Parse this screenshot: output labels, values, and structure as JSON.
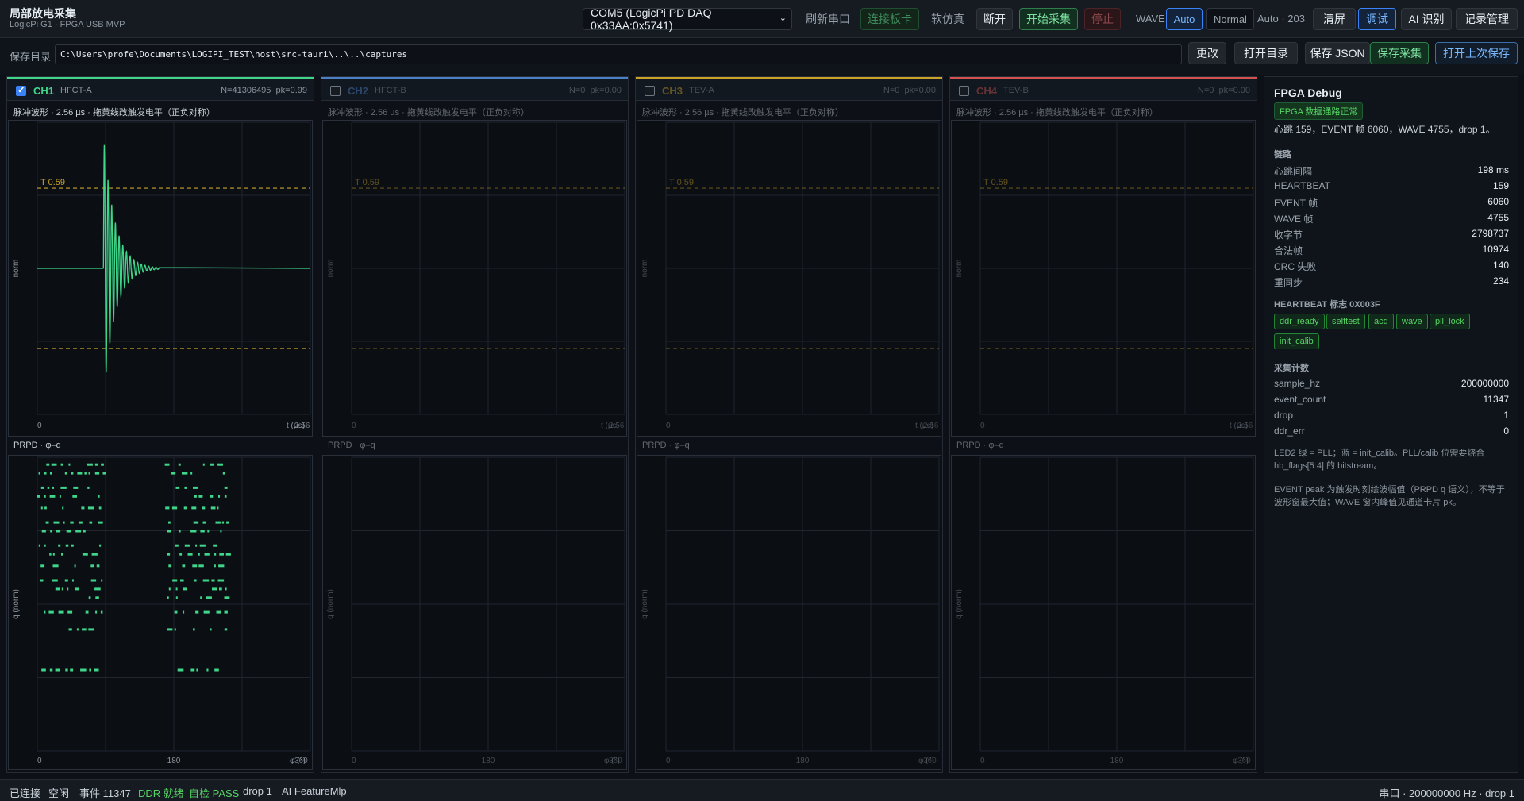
{
  "app": {
    "title": "局部放电采集",
    "subtitle": "LogicPi G1 · FPGA USB MVP"
  },
  "toolbar": {
    "port": "COM5 (LogicPi PD DAQ 0x33AA:0x5741)",
    "refresh": "刷新串口",
    "connect": "连接板卡",
    "simulate": "软仿真",
    "disconnect": "断开",
    "start": "开始采集",
    "stop": "停止",
    "wave_label": "WAVE",
    "mode_auto": "Auto",
    "mode_normal": "Normal",
    "mode_status": "Auto · 203",
    "clear": "清屏",
    "debug": "调试",
    "ai": "AI 识别",
    "records": "记录管理"
  },
  "savebar": {
    "label": "保存目录",
    "path": "C:\\Users\\profe\\Documents\\LOGIPI_TEST\\host\\src-tauri\\..\\..\\captures",
    "change": "更改",
    "open_dir": "打开目录",
    "save_json": "保存 JSON",
    "save_capture": "保存采集",
    "open_last": "打开上次保存"
  },
  "channels": [
    {
      "id": "CH1",
      "name": "HFCT-A",
      "checked": true,
      "color": "#3fd68a",
      "n": "N=41306495",
      "pk": "pk=0.99",
      "active": true
    },
    {
      "id": "CH2",
      "name": "HFCT-B",
      "checked": false,
      "color": "#4b7fc8",
      "n": "N=0",
      "pk": "pk=0.00",
      "active": false
    },
    {
      "id": "CH3",
      "name": "TEV-A",
      "checked": false,
      "color": "#c9a227",
      "n": "N=0",
      "pk": "pk=0.00",
      "active": false
    },
    {
      "id": "CH4",
      "name": "TEV-B",
      "checked": false,
      "color": "#d1524f",
      "n": "N=0",
      "pk": "pk=0.00",
      "active": false
    }
  ],
  "plots": {
    "wave_caption": "脉冲波形 · 2.56 µs · 拖黄线改触发电平（正负对称）",
    "wave_ylabel": "norm",
    "wave_x0": "0",
    "wave_xend": "t (µs)",
    "wave_xmax": "2.56",
    "trigger_label": "T 0.59",
    "prpd_caption": "PRPD · φ–q",
    "prpd_ylabel": "q (norm)",
    "prpd_x0": "0",
    "prpd_xmid": "180",
    "prpd_xend": "φ (°)",
    "prpd_xmax": "360"
  },
  "chart_data": [
    {
      "type": "line",
      "title": "脉冲波形 · 2.56 µs · 拖黄线改触发电平（正负对称）",
      "xlabel": "t (µs)",
      "ylabel": "norm",
      "xlim": [
        0,
        2.56
      ],
      "ylim": [
        -1,
        1
      ],
      "trigger_level": 0.59,
      "series": [
        {
          "name": "CH1",
          "pulse_start_us": 0.62,
          "peak": 0.99,
          "decay_end_us": 1.15
        }
      ]
    },
    {
      "type": "scatter",
      "title": "PRPD · φ–q",
      "xlabel": "φ (°)",
      "ylabel": "q (norm)",
      "xlim": [
        0,
        360
      ],
      "ylim": [
        0,
        1
      ],
      "clusters": [
        {
          "phase_range": [
            0,
            88
          ],
          "q_levels": [
            0.99,
            0.96,
            0.91,
            0.88,
            0.84,
            0.79,
            0.76,
            0.71,
            0.68,
            0.64,
            0.59,
            0.56,
            0.53,
            0.48,
            0.42,
            0.28
          ]
        },
        {
          "phase_range": [
            168,
            250
          ],
          "q_levels": [
            0.99,
            0.96,
            0.91,
            0.88,
            0.84,
            0.79,
            0.76,
            0.71,
            0.68,
            0.64,
            0.59,
            0.56,
            0.53,
            0.48,
            0.42,
            0.28
          ]
        }
      ]
    }
  ],
  "debug": {
    "title": "FPGA Debug",
    "badge": "FPGA 数据通路正常",
    "summary": "心跳 159，EVENT 帧 6060，WAVE 4755，drop 1。",
    "link_title": "链路",
    "link": [
      {
        "k": "心跳间隔",
        "v": "198 ms"
      },
      {
        "k": "HEARTBEAT",
        "v": "159"
      },
      {
        "k": "EVENT 帧",
        "v": "6060"
      },
      {
        "k": "WAVE 帧",
        "v": "4755"
      },
      {
        "k": "收字节",
        "v": "2798737"
      },
      {
        "k": "合法帧",
        "v": "10974"
      },
      {
        "k": "CRC 失败",
        "v": "140"
      },
      {
        "k": "重同步",
        "v": "234"
      }
    ],
    "hb_title": "HEARTBEAT 标志 0X003F",
    "flags": [
      "ddr_ready",
      "selftest",
      "acq",
      "wave",
      "pll_lock",
      "init_calib"
    ],
    "acq_title": "采集计数",
    "acq": [
      {
        "k": "sample_hz",
        "v": "200000000"
      },
      {
        "k": "event_count",
        "v": "11347"
      },
      {
        "k": "drop",
        "v": "1"
      },
      {
        "k": "ddr_err",
        "v": "0"
      }
    ],
    "note1": "LED2 绿 = PLL；蓝 = init_calib。PLL/calib 位需要烧合 hb_flags[5:4] 的 bitstream。",
    "note2": "EVENT peak 为触发时刻绘波幅值（PRPD q 语义），不等于波形窗最大值；WAVE 窗内峰值见通道卡片 pk。"
  },
  "status": {
    "connected": "已连接",
    "idle": "空闲",
    "events": "事件 11347",
    "ddr": "DDR 就绪",
    "selftest": "自检 PASS",
    "drop": "drop 1",
    "ai": "AI FeatureMlp",
    "right": "串口 · 200000000 Hz · drop 1"
  }
}
